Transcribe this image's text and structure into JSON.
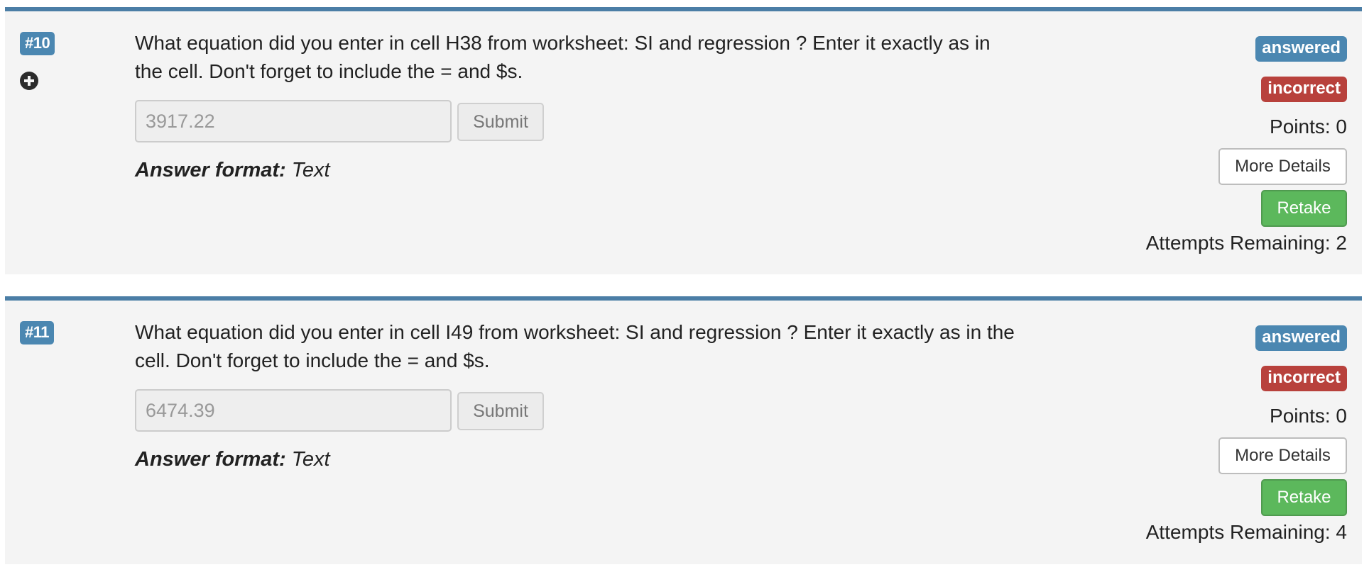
{
  "questions": [
    {
      "number": "#10",
      "text": "What equation did you enter in cell H38 from worksheet: SI and regression ? Enter it exactly as in the cell. Don't forget to include the = and $s.",
      "answer_value": "3917.22",
      "submit_label": "Submit",
      "answer_format_label": "Answer format:",
      "answer_format_value": "Text",
      "status_answered": "answered",
      "status_result": "incorrect",
      "points_text": "Points: 0",
      "more_details_label": "More Details",
      "retake_label": "Retake",
      "attempts_text": "Attempts Remaining: 2",
      "expand_icon": "plus-circle-icon"
    },
    {
      "number": "#11",
      "text": "What equation did you enter in cell I49 from worksheet: SI and regression ? Enter it exactly as in the cell. Don't forget to include the = and $s.",
      "answer_value": "6474.39",
      "submit_label": "Submit",
      "answer_format_label": "Answer format:",
      "answer_format_value": "Text",
      "status_answered": "answered",
      "status_result": "incorrect",
      "points_text": "Points: 0",
      "more_details_label": "More Details",
      "retake_label": "Retake",
      "attempts_text": "Attempts Remaining: 4"
    }
  ],
  "colors": {
    "card_border": "#4b7ea6",
    "badge_answered": "#4b87b1",
    "badge_incorrect": "#b8413c",
    "retake_green": "#5cb85c"
  }
}
